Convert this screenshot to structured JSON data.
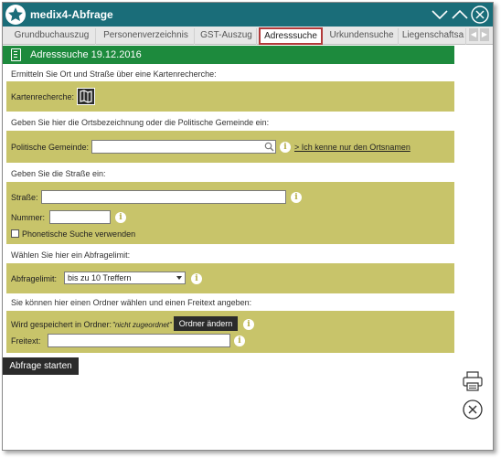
{
  "window": {
    "title": "medix4-Abfrage",
    "controls": [
      "chevron-down-icon",
      "chevron-up-icon",
      "close-icon"
    ]
  },
  "tabs": [
    {
      "label": "Grundbuchauszug",
      "active": false
    },
    {
      "label": "Personenverzeichnis",
      "active": false
    },
    {
      "label": "GST-Auszug",
      "active": false
    },
    {
      "label": "Adresssuche",
      "active": true
    },
    {
      "label": "Urkundensuche",
      "active": false
    },
    {
      "label": "Liegenschaftsa",
      "active": false
    }
  ],
  "section": {
    "title": "Adresssuche 19.12.2016"
  },
  "map": {
    "instruction": "Ermitteln Sie Ort und Straße über eine Kartenrecherche:",
    "label": "Kartenrecherche:"
  },
  "municipality": {
    "instruction": "Geben Sie hier die Ortsbezeichnung oder die Politische Gemeinde ein:",
    "label": "Politische Gemeinde:",
    "value": "",
    "link": "> Ich kenne nur den Ortsnamen"
  },
  "street": {
    "instruction": "Geben Sie die Straße ein:",
    "street_label": "Straße:",
    "street_value": "",
    "number_label": "Nummer:",
    "number_value": "",
    "phonetic_label": "Phonetische Suche verwenden",
    "phonetic_checked": false
  },
  "limit": {
    "instruction": "Wählen Sie hier ein Abfragelimit:",
    "label": "Abfragelimit:",
    "selected": "bis zu 10 Treffern"
  },
  "folder": {
    "instruction": "Sie können hier einen Ordner wählen und einen Freitext angeben:",
    "saved_label": "Wird gespeichert in Ordner:",
    "saved_value": "\"nicht zugeordnet\"",
    "change_button": "Ordner ändern",
    "freetext_label": "Freitext:",
    "freetext_value": ""
  },
  "actions": {
    "start_button": "Abfrage starten"
  },
  "colors": {
    "titlebar": "#1a6d79",
    "section_header": "#1d8a3d",
    "panel": "#c8c46a",
    "active_tab_border": "#b23a3a"
  }
}
